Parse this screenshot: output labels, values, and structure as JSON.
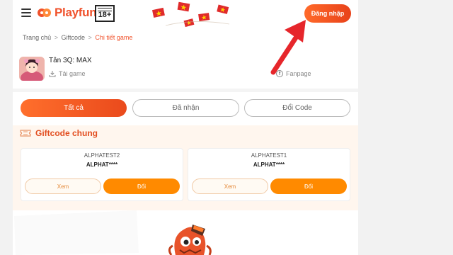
{
  "header": {
    "logo_text": "Playfun",
    "age_rating": "18+",
    "login_label": "Đăng nhập"
  },
  "breadcrumb": {
    "home": "Trang chủ",
    "separator": ">",
    "giftcode": "Giftcode",
    "current": "Chi tiết game"
  },
  "game": {
    "name": "Tân 3Q: MAX",
    "download_label": "Tải game",
    "fanpage_label": "Fanpage"
  },
  "tabs": [
    {
      "label": "Tất cả",
      "active": true
    },
    {
      "label": "Đã nhận",
      "active": false
    },
    {
      "label": "Đổi Code",
      "active": false
    }
  ],
  "section": {
    "title": "Giftcode chung",
    "cards": [
      {
        "name": "ALPHATEST2",
        "code": "ALPHAT****",
        "view_label": "Xem",
        "redeem_label": "Đổi"
      },
      {
        "name": "ALPHATEST1",
        "code": "ALPHAT****",
        "view_label": "Xem",
        "redeem_label": "Đổi"
      }
    ]
  },
  "icons": {
    "menu": "hamburger-menu-icon",
    "download": "download-icon",
    "facebook": "facebook-icon",
    "ticket": "ticket-icon",
    "arrow": "red-arrow-annotation"
  },
  "colors": {
    "brand": "#f0522c",
    "accent_orange": "#ff8a00",
    "annotation_red": "#e6262b"
  }
}
